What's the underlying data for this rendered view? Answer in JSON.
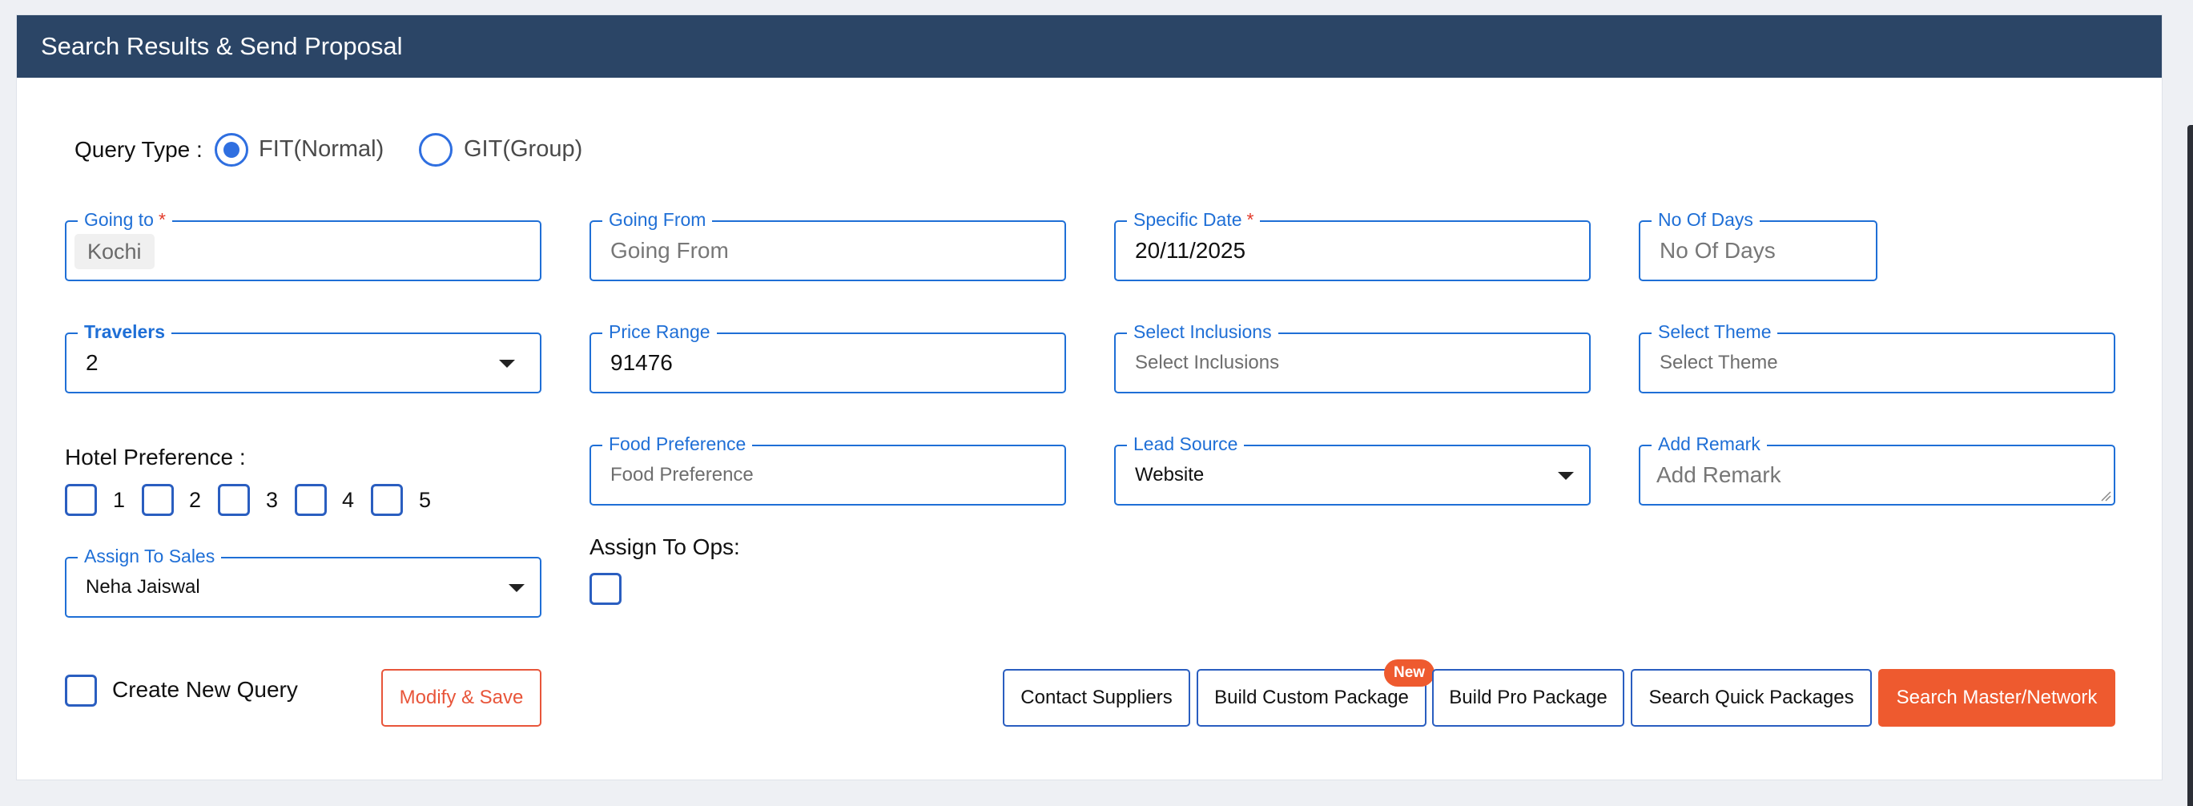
{
  "header": {
    "title": "Search Results & Send Proposal"
  },
  "query_type": {
    "label": "Query Type :",
    "options": [
      {
        "label": "FIT(Normal)",
        "checked": true
      },
      {
        "label": "GIT(Group)",
        "checked": false
      }
    ]
  },
  "fields": {
    "going_to": {
      "label": "Going to",
      "required": "*",
      "value": "Kochi"
    },
    "going_from": {
      "label": "Going From",
      "placeholder": "Going From"
    },
    "specific_date": {
      "label": "Specific Date",
      "required": "*",
      "value": "20/11/2025"
    },
    "no_of_days": {
      "label": "No Of Days",
      "placeholder": "No Of Days"
    },
    "travelers": {
      "label": "Travelers",
      "value": "2"
    },
    "price_range": {
      "label": "Price Range",
      "value": "91476"
    },
    "select_inclusions": {
      "label": "Select Inclusions",
      "placeholder": "Select Inclusions"
    },
    "select_theme": {
      "label": "Select Theme",
      "placeholder": "Select Theme"
    },
    "food_preference": {
      "label": "Food Preference",
      "placeholder": "Food Preference"
    },
    "lead_source": {
      "label": "Lead Source",
      "value": "Website"
    },
    "add_remark": {
      "label": "Add Remark",
      "placeholder": "Add Remark"
    },
    "assign_to_sales": {
      "label": "Assign To Sales",
      "value": "Neha Jaiswal"
    }
  },
  "hotel_preference": {
    "label": "Hotel Preference :",
    "options": [
      "1",
      "2",
      "3",
      "4",
      "5"
    ]
  },
  "assign_to_ops": {
    "label": "Assign To Ops:"
  },
  "create_new_query": {
    "label": "Create New Query"
  },
  "buttons": {
    "modify_save": "Modify & Save",
    "contact_suppliers": "Contact Suppliers",
    "build_custom_package": "Build Custom Package",
    "new_badge": "New",
    "build_pro_package": "Build Pro Package",
    "search_quick_packages": "Search Quick Packages",
    "search_master_network": "Search Master/Network"
  },
  "colors": {
    "header_bg": "#2b4566",
    "accent_blue": "#1f6fd6",
    "accent_orange": "#ee5a2f",
    "required_red": "#e23a2a"
  }
}
